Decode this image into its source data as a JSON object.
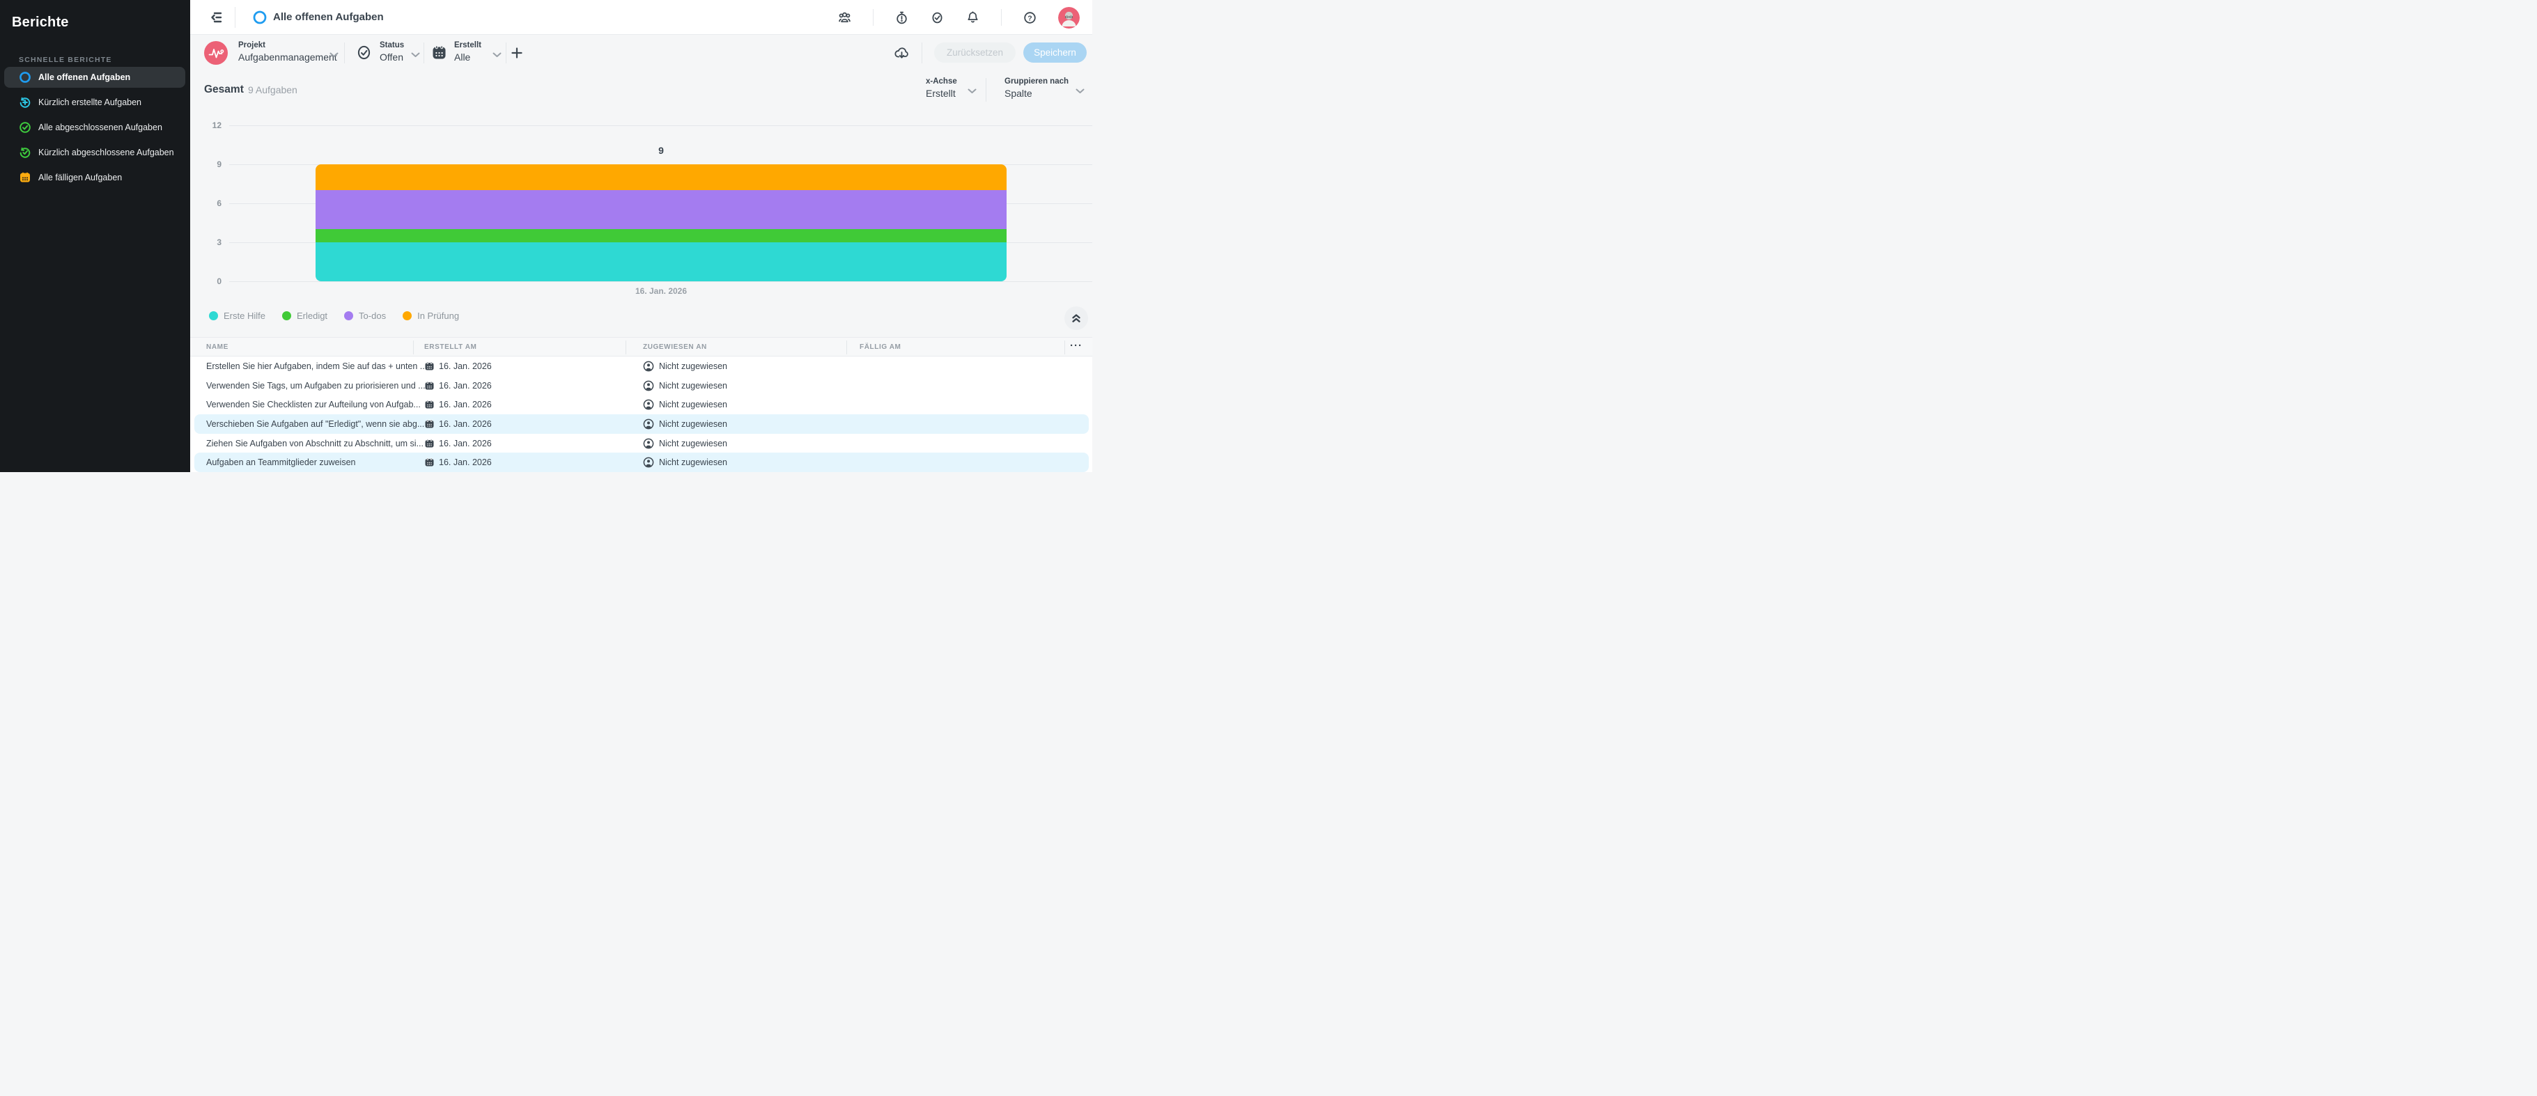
{
  "sidebar": {
    "title": "Berichte",
    "section_label": "SCHNELLE BERICHTE",
    "items": [
      {
        "label": "Alle offenen Aufgaben"
      },
      {
        "label": "Kürzlich erstellte Aufgaben"
      },
      {
        "label": "Alle abgeschlossenen Aufgaben"
      },
      {
        "label": "Kürzlich abgeschlossene Aufgaben"
      },
      {
        "label": "Alle fälligen Aufgaben"
      }
    ]
  },
  "topbar": {
    "title": "Alle offenen Aufgaben"
  },
  "filters": {
    "project": {
      "label": "Projekt",
      "value": "Aufgabenmanagement"
    },
    "status": {
      "label": "Status",
      "value": "Offen"
    },
    "created": {
      "label": "Erstellt",
      "value": "Alle"
    },
    "reset_label": "Zurücksetzen",
    "save_label": "Speichern"
  },
  "chart_header": {
    "title": "Gesamt",
    "subtitle": "9 Aufgaben",
    "x_axis": {
      "label": "x-Achse",
      "value": "Erstellt"
    },
    "group_by": {
      "label": "Gruppieren nach",
      "value": "Spalte"
    }
  },
  "chart_data": {
    "type": "bar",
    "stacked": true,
    "title": "Gesamt",
    "subtitle": "9 Aufgaben",
    "categories": [
      "16. Jan. 2026"
    ],
    "series": [
      {
        "name": "Erste Hilfe",
        "values": [
          3
        ],
        "color": "#2ed9d3"
      },
      {
        "name": "Erledigt",
        "values": [
          1
        ],
        "color": "#40ca37"
      },
      {
        "name": "To-dos",
        "values": [
          3
        ],
        "color": "#a47cf0"
      },
      {
        "name": "In Prüfung",
        "values": [
          2
        ],
        "color": "#ffa800"
      }
    ],
    "total": 9,
    "total_label": "9",
    "ylim": [
      0,
      12
    ],
    "ytick_labels": [
      "12",
      "9",
      "6",
      "3",
      "0"
    ],
    "grid": true,
    "legend_position": "bottom"
  },
  "table": {
    "columns": [
      "NAME",
      "ERSTELLT AM",
      "ZUGEWIESEN AN",
      "FÄLLIG AM"
    ],
    "menu_icon": "···",
    "rows": [
      {
        "name": "Erstellen Sie hier Aufgaben, indem Sie auf das + unten ...",
        "created": "16. Jan. 2026",
        "assignee": "Nicht zugewiesen",
        "due": ""
      },
      {
        "name": "Verwenden Sie Tags, um Aufgaben zu priorisieren und ...",
        "created": "16. Jan. 2026",
        "assignee": "Nicht zugewiesen",
        "due": ""
      },
      {
        "name": "Verwenden Sie Checklisten zur Aufteilung von Aufgab...",
        "created": "16. Jan. 2026",
        "assignee": "Nicht zugewiesen",
        "due": ""
      },
      {
        "name": "Verschieben Sie Aufgaben auf \"Erledigt\", wenn sie abg...",
        "created": "16. Jan. 2026",
        "assignee": "Nicht zugewiesen",
        "due": ""
      },
      {
        "name": "Ziehen Sie Aufgaben von Abschnitt zu Abschnitt, um si...",
        "created": "16. Jan. 2026",
        "assignee": "Nicht zugewiesen",
        "due": ""
      },
      {
        "name": "Aufgaben an Teammitglieder zuweisen",
        "created": "16. Jan. 2026",
        "assignee": "Nicht zugewiesen",
        "due": ""
      }
    ]
  },
  "colors": {
    "accent_blue": "#1f9cf0",
    "sidebar_bg": "#171a1d",
    "highlight_row": "#e4f5fd",
    "project_pink": "#ec6176",
    "save_button": "#aad5f3"
  }
}
